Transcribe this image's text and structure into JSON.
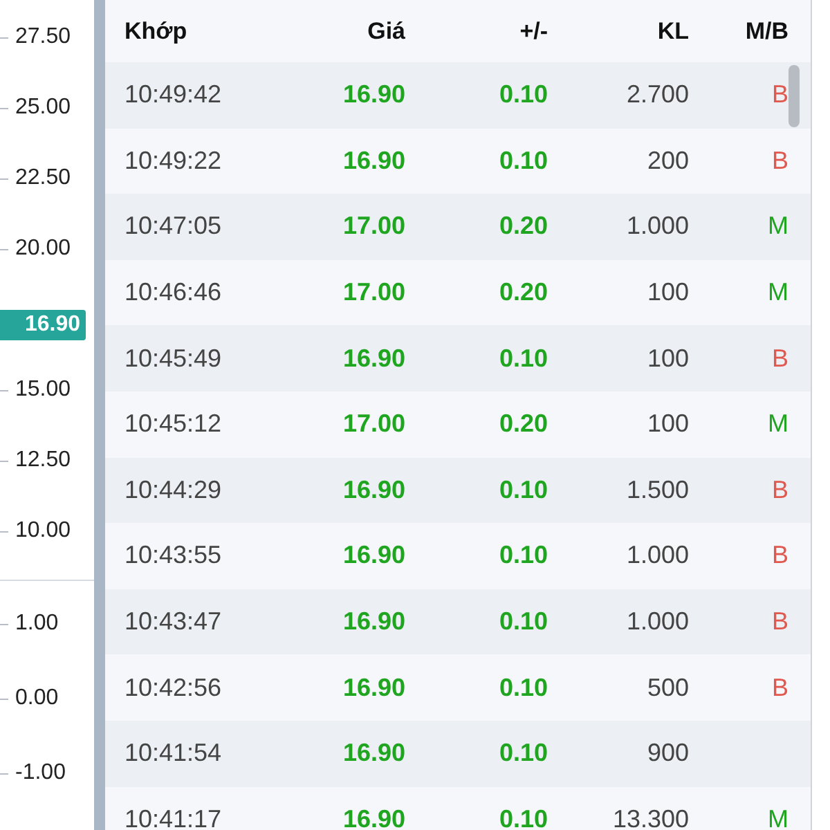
{
  "price_axis": {
    "upper_ticks_above": [
      "27.50",
      "25.00",
      "22.50",
      "20.00"
    ],
    "last_price": "16.90",
    "upper_ticks_below": [
      "15.00",
      "12.50",
      "10.00"
    ],
    "lower_ticks": [
      "1.00",
      "0.00",
      "-1.00"
    ]
  },
  "table": {
    "columns": [
      "Khớp",
      "Giá",
      "+/-",
      "KL",
      "M/B"
    ],
    "rows": [
      {
        "time": "10:49:42",
        "price": "16.90",
        "change": "0.10",
        "volume": "2.700",
        "side": {
          "text": "B",
          "color": "#e0584e"
        }
      },
      {
        "time": "10:49:22",
        "price": "16.90",
        "change": "0.10",
        "volume": "200",
        "side": {
          "text": "B",
          "color": "#e0584e"
        }
      },
      {
        "time": "10:47:05",
        "price": "17.00",
        "change": "0.20",
        "volume": "1.000",
        "side": {
          "text": "M",
          "color": "#1fa51f"
        }
      },
      {
        "time": "10:46:46",
        "price": "17.00",
        "change": "0.20",
        "volume": "100",
        "side": {
          "text": "M",
          "color": "#1fa51f"
        }
      },
      {
        "time": "10:45:49",
        "price": "16.90",
        "change": "0.10",
        "volume": "100",
        "side": {
          "text": "B",
          "color": "#e0584e"
        }
      },
      {
        "time": "10:45:12",
        "price": "17.00",
        "change": "0.20",
        "volume": "100",
        "side": {
          "text": "M",
          "color": "#1fa51f"
        }
      },
      {
        "time": "10:44:29",
        "price": "16.90",
        "change": "0.10",
        "volume": "1.500",
        "side": {
          "text": "B",
          "color": "#e0584e"
        }
      },
      {
        "time": "10:43:55",
        "price": "16.90",
        "change": "0.10",
        "volume": "1.000",
        "side": {
          "text": "B",
          "color": "#e0584e"
        }
      },
      {
        "time": "10:43:47",
        "price": "16.90",
        "change": "0.10",
        "volume": "1.000",
        "side": {
          "text": "B",
          "color": "#e0584e"
        }
      },
      {
        "time": "10:42:56",
        "price": "16.90",
        "change": "0.10",
        "volume": "500",
        "side": {
          "text": "B",
          "color": "#e0584e"
        }
      },
      {
        "time": "10:41:54",
        "price": "16.90",
        "change": "0.10",
        "volume": "900"
      },
      {
        "time": "10:41:17",
        "price": "16.90",
        "change": "0.10",
        "volume": "13.300",
        "side": {
          "text": "M",
          "color": "#1fa51f"
        }
      }
    ]
  }
}
